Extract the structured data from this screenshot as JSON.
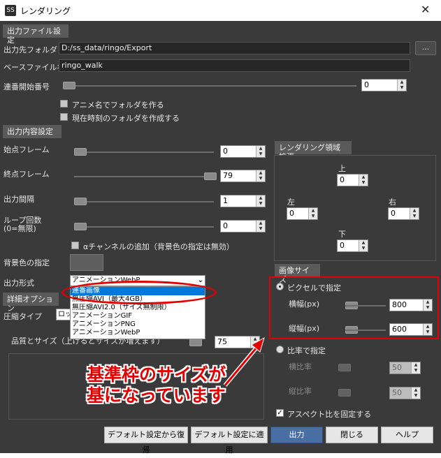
{
  "window": {
    "title": "レンダリング",
    "app_icon": "SS",
    "close_glyph": "✕"
  },
  "output_file": {
    "section": "出力ファイル設定",
    "folder_label": "出力先フォルダ",
    "folder_value": "D:/ss_data/ringo/Export",
    "browse_label": "...",
    "basename_label": "ベースファイル名",
    "basename_value": "ringo_walk",
    "start_number_label": "連番開始番号",
    "start_number_value": "0",
    "chk_anim_folder": "アニメ名でフォルダを作る",
    "chk_time_folder": "現在時刻のフォルダを作成する"
  },
  "output_content": {
    "section": "出力内容設定",
    "start_frame_label": "始点フレーム",
    "start_frame_value": "0",
    "end_frame_label": "終点フレーム",
    "end_frame_value": "79",
    "interval_label": "出力間隔",
    "interval_value": "1",
    "loop_label": "ループ回数\n(0=無限)",
    "loop_value": "0",
    "alpha_label": "αチャンネルの追加（背景色の指定は無効）",
    "bg_color_label": "背景色の指定",
    "format_label": "出力形式",
    "format_value": "アニメーションWebP",
    "format_options": [
      "連番画像",
      "無圧縮AVI（最大4GB）",
      "無圧縮AVI2.0（サイズ無制限）",
      "アニメーションGIF",
      "アニメーションPNG",
      "アニメーションWebP"
    ]
  },
  "detail": {
    "tab": "詳細オプション",
    "compress_label": "圧縮タイプ",
    "compress_value": "ロッ",
    "quality_label": "品質とサイズ（上げるとサイズが増えます）",
    "quality_value": "75"
  },
  "expand": {
    "section": "レンダリング領域拡張",
    "top_label": "上",
    "top_value": "0",
    "left_label": "左",
    "left_value": "0",
    "right_label": "右",
    "right_value": "0",
    "bottom_label": "下",
    "bottom_value": "0"
  },
  "image_size": {
    "section": "画像サイズ",
    "pixel_radio": "ピクセルで指定",
    "width_label": "横幅(px)",
    "width_value": "800",
    "height_label": "縦幅(px)",
    "height_value": "600",
    "ratio_radio": "比率で指定",
    "hratio_label": "横比率",
    "hratio_value": "50",
    "vratio_label": "縦比率",
    "vratio_value": "50",
    "aspect_label": "アスペクト比を固定する"
  },
  "annotation": {
    "line1": "基準枠のサイズが",
    "line2": "基になっています",
    "color": "#e00000"
  },
  "buttons": {
    "restore": "デフォルト設定から復帰",
    "apply_default": "デフォルト設定に適用",
    "output": "出力",
    "close": "閉じる",
    "help": "ヘルプ"
  }
}
